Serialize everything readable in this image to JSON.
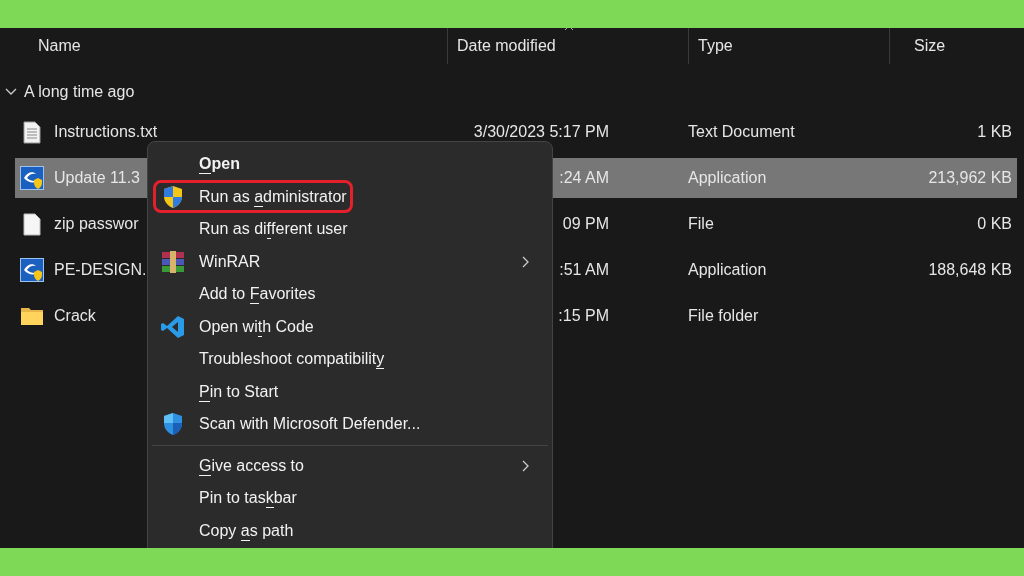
{
  "columns": [
    {
      "label": "Name",
      "sorted": false
    },
    {
      "label": "Date modified",
      "sorted": true
    },
    {
      "label": "Type",
      "sorted": false
    },
    {
      "label": "Size",
      "sorted": false
    }
  ],
  "group": {
    "label": "A long time ago",
    "expanded": true
  },
  "files": [
    {
      "kind": "text",
      "name": "Instructions.txt",
      "date": "3/30/2023 5:17 PM",
      "type": "Text Document",
      "size": "1 KB",
      "selected": false
    },
    {
      "kind": "app",
      "name": "Update 11.3",
      "date": ":24 AM",
      "type": "Application",
      "size": "213,962 KB",
      "selected": true
    },
    {
      "kind": "blank",
      "name": "zip passwor",
      "date": "09 PM",
      "type": "File",
      "size": "0 KB",
      "selected": false
    },
    {
      "kind": "app",
      "name": "PE-DESIGN.",
      "date": ":51 AM",
      "type": "Application",
      "size": "188,648 KB",
      "selected": false
    },
    {
      "kind": "folder",
      "name": "Crack",
      "date": ":15 PM",
      "type": "File folder",
      "selected": false
    }
  ],
  "menu": [
    {
      "kind": "plain",
      "default": true,
      "highlighted": false,
      "submenu": false,
      "parts": [
        {
          "text": "O",
          "underline": true
        },
        {
          "text": "pen",
          "underline": false
        }
      ]
    },
    {
      "kind": "uac",
      "default": false,
      "highlighted": true,
      "submenu": false,
      "parts": [
        {
          "text": "Run as ",
          "underline": false
        },
        {
          "text": "a",
          "underline": true
        },
        {
          "text": "dministrator",
          "underline": false
        }
      ]
    },
    {
      "kind": "plain",
      "default": false,
      "highlighted": false,
      "submenu": false,
      "parts": [
        {
          "text": "Run as di",
          "underline": false
        },
        {
          "text": "f",
          "underline": true
        },
        {
          "text": "ferent user",
          "underline": false
        }
      ]
    },
    {
      "kind": "archiver",
      "default": false,
      "highlighted": false,
      "submenu": true,
      "parts": [
        {
          "text": "WinRAR",
          "underline": false
        }
      ]
    },
    {
      "kind": "plain",
      "default": false,
      "highlighted": false,
      "submenu": false,
      "parts": [
        {
          "text": "Add to ",
          "underline": false
        },
        {
          "text": "F",
          "underline": true
        },
        {
          "text": "avorites",
          "underline": false
        }
      ]
    },
    {
      "kind": "editor",
      "default": false,
      "highlighted": false,
      "submenu": false,
      "parts": [
        {
          "text": "Open wi",
          "underline": false
        },
        {
          "text": "t",
          "underline": true
        },
        {
          "text": "h Code",
          "underline": false
        }
      ]
    },
    {
      "kind": "plain",
      "default": false,
      "highlighted": false,
      "submenu": false,
      "parts": [
        {
          "text": "Troubleshoot compatibilit",
          "underline": false
        },
        {
          "text": "y",
          "underline": true
        }
      ]
    },
    {
      "kind": "plain",
      "default": false,
      "highlighted": false,
      "submenu": false,
      "parts": [
        {
          "text": "P",
          "underline": true
        },
        {
          "text": "in to Start",
          "underline": false
        }
      ]
    },
    {
      "kind": "defender",
      "default": false,
      "highlighted": false,
      "submenu": false,
      "parts": [
        {
          "text": "Scan with Microsoft Defender...",
          "underline": false
        }
      ]
    },
    {
      "kind": "separator"
    },
    {
      "kind": "plain",
      "default": false,
      "highlighted": false,
      "submenu": true,
      "parts": [
        {
          "text": "G",
          "underline": true
        },
        {
          "text": "ive access to",
          "underline": false
        }
      ]
    },
    {
      "kind": "plain",
      "default": false,
      "highlighted": false,
      "submenu": false,
      "parts": [
        {
          "text": "Pin to tas",
          "underline": false
        },
        {
          "text": "k",
          "underline": true
        },
        {
          "text": "bar",
          "underline": false
        }
      ]
    },
    {
      "kind": "plain",
      "default": false,
      "highlighted": false,
      "submenu": false,
      "parts": [
        {
          "text": "Copy ",
          "underline": false
        },
        {
          "text": "a",
          "underline": true
        },
        {
          "text": "s path",
          "underline": false
        }
      ]
    }
  ]
}
